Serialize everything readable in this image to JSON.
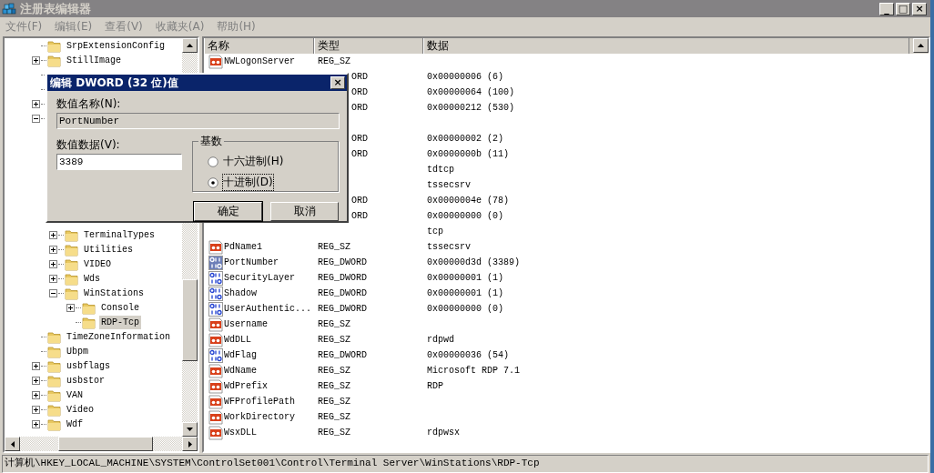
{
  "window": {
    "title": "注册表编辑器",
    "controls": [
      "_",
      "□",
      "×"
    ]
  },
  "menu": [
    "文件(F)",
    "编辑(E)",
    "查看(V)",
    "收藏夹(A)",
    "帮助(H)"
  ],
  "tree": [
    {
      "kind": "key",
      "name": "SrpExtensionConfig",
      "selected": false
    },
    {
      "kind": "key",
      "name": "StillImage",
      "expanded": false,
      "selected": false
    },
    {
      "kind": "covered"
    },
    {
      "kind": "covered"
    },
    {
      "kind": "covered",
      "expanded": false
    },
    {
      "kind": "covered",
      "expanded": true,
      "children": [
        {
          "kind": "covered"
        },
        {
          "kind": "covered"
        },
        {
          "kind": "covered"
        },
        {
          "kind": "covered"
        },
        {
          "kind": "covered"
        },
        {
          "kind": "covered"
        },
        {
          "kind": "covered"
        },
        {
          "kind": "key",
          "name": "TerminalTypes",
          "expanded": false,
          "selected": false
        },
        {
          "kind": "key",
          "name": "Utilities",
          "expanded": false,
          "selected": false
        },
        {
          "kind": "key",
          "name": "VIDEO",
          "expanded": false,
          "selected": false
        },
        {
          "kind": "key",
          "name": "Wds",
          "expanded": false,
          "selected": false
        },
        {
          "kind": "key",
          "name": "WinStations",
          "expanded": true,
          "selected": false,
          "children": [
            {
              "kind": "key",
              "name": "Console",
              "expanded": false,
              "selected": false
            },
            {
              "kind": "key",
              "name": "RDP-Tcp",
              "selected": true
            }
          ]
        }
      ]
    },
    {
      "kind": "key",
      "name": "TimeZoneInformation",
      "selected": false
    },
    {
      "kind": "key",
      "name": "Ubpm",
      "selected": false
    },
    {
      "kind": "key",
      "name": "usbflags",
      "expanded": false,
      "selected": false
    },
    {
      "kind": "key",
      "name": "usbstor",
      "expanded": false,
      "selected": false
    },
    {
      "kind": "key",
      "name": "VAN",
      "expanded": false,
      "selected": false
    },
    {
      "kind": "key",
      "name": "Video",
      "expanded": false,
      "selected": false
    },
    {
      "kind": "key",
      "name": "Wdf",
      "expanded": false,
      "selected": false
    }
  ],
  "table": {
    "columns": [
      "名称",
      "类型",
      "数据"
    ],
    "rows": [
      {
        "kind": "string",
        "name": "NWLogonServer",
        "type": "REG_SZ"
      },
      {
        "kind": "covered",
        "type": "ORD",
        "data": "0x00000006 (6)"
      },
      {
        "kind": "covered",
        "type": "ORD",
        "data": "0x00000064 (100)"
      },
      {
        "kind": "covered",
        "type": "ORD",
        "data": "0x00000212 (530)"
      },
      {
        "kind": "covered"
      },
      {
        "kind": "covered",
        "type": "ORD",
        "data": "0x00000002 (2)"
      },
      {
        "kind": "covered",
        "type": "ORD",
        "data": "0x0000000b (11)"
      },
      {
        "kind": "covered",
        "data": "tdtcp"
      },
      {
        "kind": "covered",
        "data": "tssecsrv"
      },
      {
        "kind": "covered",
        "type": "ORD",
        "data": "0x0000004e (78)"
      },
      {
        "kind": "covered",
        "type": "ORD",
        "data": "0x00000000 (0)"
      },
      {
        "kind": "covered",
        "data": "tcp"
      },
      {
        "kind": "string",
        "name": "PdName1",
        "type": "REG_SZ",
        "data": "tssecsrv"
      },
      {
        "kind": "dword",
        "name": "PortNumber",
        "type": "REG_DWORD",
        "data": "0x00000d3d (3389)",
        "selected": true
      },
      {
        "kind": "dword",
        "name": "SecurityLayer",
        "type": "REG_DWORD",
        "data": "0x00000001 (1)",
        "selected": false
      },
      {
        "kind": "dword",
        "name": "Shadow",
        "type": "REG_DWORD",
        "data": "0x00000001 (1)",
        "selected": false
      },
      {
        "kind": "dword",
        "name": "UserAuthentic...",
        "type": "REG_DWORD",
        "data": "0x00000000 (0)",
        "selected": false
      },
      {
        "kind": "string",
        "name": "Username",
        "type": "REG_SZ"
      },
      {
        "kind": "string",
        "name": "WdDLL",
        "type": "REG_SZ",
        "data": "rdpwd"
      },
      {
        "kind": "dword",
        "name": "WdFlag",
        "type": "REG_DWORD",
        "data": "0x00000036 (54)",
        "selected": false
      },
      {
        "kind": "string",
        "name": "WdName",
        "type": "REG_SZ",
        "data": "Microsoft RDP 7.1"
      },
      {
        "kind": "string",
        "name": "WdPrefix",
        "type": "REG_SZ",
        "data": "RDP"
      },
      {
        "kind": "string",
        "name": "WFProfilePath",
        "type": "REG_SZ"
      },
      {
        "kind": "string",
        "name": "WorkDirectory",
        "type": "REG_SZ"
      },
      {
        "kind": "string",
        "name": "WsxDLL",
        "type": "REG_SZ",
        "data": "rdpwsx"
      }
    ]
  },
  "dialog": {
    "title": "编辑 DWORD (32 位)值",
    "close": "×",
    "name_label": "数值名称(N):",
    "name_value": "PortNumber",
    "data_label": "数值数据(V):",
    "data_value": "3389",
    "base_label": "基数",
    "bases": [
      {
        "label": "十六进制(H)",
        "selected": false
      },
      {
        "label": "十进制(D)",
        "selected": true
      }
    ],
    "buttons": [
      {
        "label": "确定",
        "default": true
      },
      {
        "label": "取消",
        "default": false
      }
    ]
  },
  "status_bar": "计算机\\HKEY_LOCAL_MACHINE\\SYSTEM\\ControlSet001\\Control\\Terminal Server\\WinStations\\RDP-Tcp"
}
